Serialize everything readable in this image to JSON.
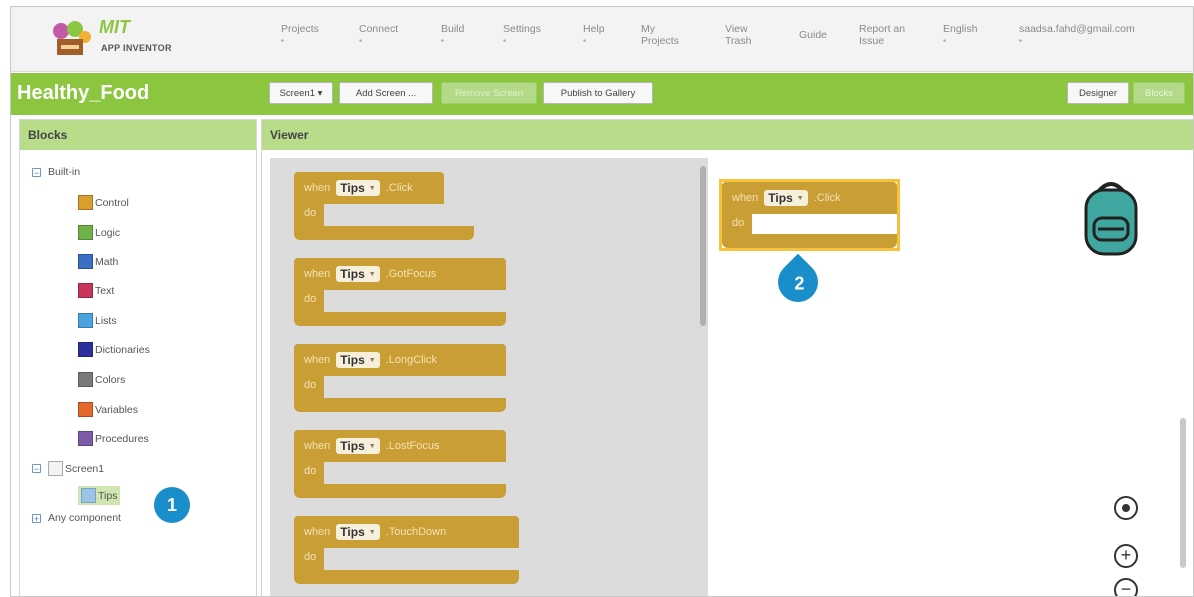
{
  "app": {
    "logo_title": "MIT",
    "logo_subtitle": "APP INVENTOR",
    "menu": [
      {
        "label": "Projects",
        "dropdown": true
      },
      {
        "label": "Connect",
        "dropdown": true
      },
      {
        "label": "Build",
        "dropdown": true
      },
      {
        "label": "Settings",
        "dropdown": true
      },
      {
        "label": "Help",
        "dropdown": true
      },
      {
        "label": "My Projects",
        "dropdown": false
      },
      {
        "label": "View Trash",
        "dropdown": false
      },
      {
        "label": "Guide",
        "dropdown": false
      },
      {
        "label": "Report an Issue",
        "dropdown": false
      },
      {
        "label": "English",
        "dropdown": true
      },
      {
        "label": "saadsa.fahd@gmail.com",
        "dropdown": true
      }
    ]
  },
  "toolbar": {
    "project_name": "Healthy_Food",
    "screen_select": "Screen1 ▾",
    "add_screen": "Add Screen ...",
    "remove_screen": "Remove Screen",
    "publish": "Publish to Gallery",
    "designer": "Designer",
    "blocks": "Blocks"
  },
  "blocks_panel": {
    "title": "Blocks",
    "builtin_label": "Built-in",
    "builtin_items": [
      {
        "label": "Control",
        "color": "#d89e2e"
      },
      {
        "label": "Logic",
        "color": "#6fb24a"
      },
      {
        "label": "Math",
        "color": "#3a6fc4"
      },
      {
        "label": "Text",
        "color": "#c7355a"
      },
      {
        "label": "Lists",
        "color": "#4aa3df"
      },
      {
        "label": "Dictionaries",
        "color": "#2d2f9b"
      },
      {
        "label": "Colors",
        "color": "#7a7a7a"
      },
      {
        "label": "Variables",
        "color": "#e4672c"
      },
      {
        "label": "Procedures",
        "color": "#7c5ca8"
      }
    ],
    "screen_label": "Screen1",
    "component_label": "Tips",
    "any_component_label": "Any component"
  },
  "viewer": {
    "title": "Viewer",
    "flyout_blocks": [
      {
        "when": "when",
        "component": "Tips",
        "event": ".Click",
        "do": "do"
      },
      {
        "when": "when",
        "component": "Tips",
        "event": ".GotFocus",
        "do": "do"
      },
      {
        "when": "when",
        "component": "Tips",
        "event": ".LongClick",
        "do": "do"
      },
      {
        "when": "when",
        "component": "Tips",
        "event": ".LostFocus",
        "do": "do"
      },
      {
        "when": "when",
        "component": "Tips",
        "event": ".TouchDown",
        "do": "do"
      }
    ],
    "workspace_block": {
      "when": "when",
      "component": "Tips",
      "event": ".Click",
      "do": "do"
    }
  },
  "callouts": {
    "one": "1",
    "two": "2"
  },
  "icons": [
    "backpack-icon",
    "recenter-icon",
    "zoom-in-icon",
    "zoom-out-icon",
    "dropdown-arrow-icon",
    "tree-toggle-icon"
  ]
}
